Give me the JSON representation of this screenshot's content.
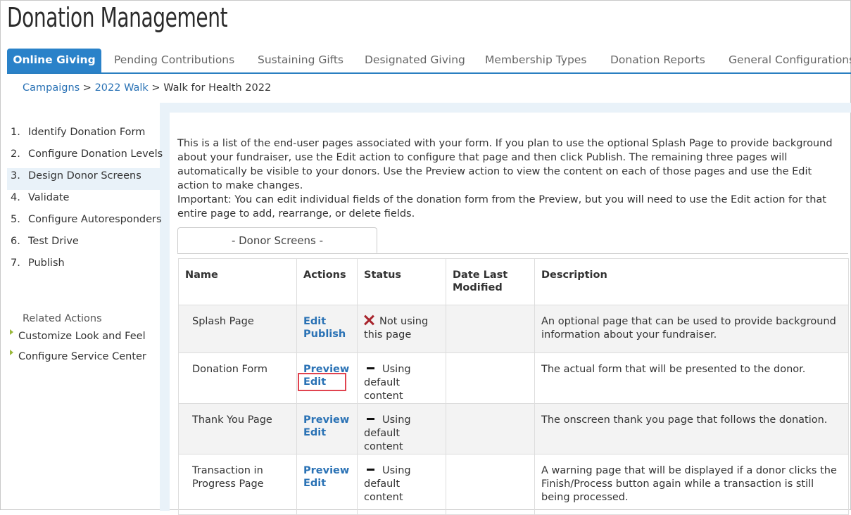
{
  "app": {
    "title": "Donation Management"
  },
  "tabs": [
    {
      "label": "Online Giving",
      "active": true
    },
    {
      "label": "Pending Contributions"
    },
    {
      "label": "Sustaining Gifts"
    },
    {
      "label": "Designated Giving"
    },
    {
      "label": "Membership Types"
    },
    {
      "label": "Donation Reports"
    },
    {
      "label": "General Configurations"
    }
  ],
  "breadcrumb": {
    "campaigns": "Campaigns",
    "sep1": " > ",
    "walk": "2022 Walk",
    "sep2": " > ",
    "current": "Walk for Health 2022"
  },
  "steps": [
    {
      "num": "1.",
      "label": "Identify Donation Form"
    },
    {
      "num": "2.",
      "label": "Configure Donation Levels"
    },
    {
      "num": "3.",
      "label": "Design Donor Screens",
      "active": true
    },
    {
      "num": "4.",
      "label": "Validate"
    },
    {
      "num": "5.",
      "label": "Configure Autoresponders"
    },
    {
      "num": "6.",
      "label": "Test Drive"
    },
    {
      "num": "7.",
      "label": "Publish"
    }
  ],
  "related": {
    "heading": "Related Actions",
    "items": [
      "Customize Look and Feel",
      "Configure Service Center"
    ]
  },
  "intro": "This is a list of the end-user pages associated with your form. If you plan to use the optional Splash Page to provide background about your fundraiser, use the Edit action to configure that page and then click Publish. The remaining three pages will automatically be visible to your donors. Use the Preview action to view the content on each of those pages and use the Edit action to make changes.",
  "important": "Important: You can edit individual fields of the donation form from the Preview, but you will need to use the Edit action for that entire page to add, rearrange, or delete fields.",
  "subtab": "- Donor Screens -",
  "table": {
    "headers": [
      "Name",
      "Actions",
      "Status",
      "Date Last Modified",
      "Description"
    ],
    "rows": [
      {
        "name": "Splash Page",
        "action1": "Edit",
        "action2": "Publish",
        "status": "Not using this page",
        "date": "",
        "description": "An optional page that can be used to provide background information about your fundraiser."
      },
      {
        "name": "Donation Form",
        "action1": "Preview",
        "action2": "Edit",
        "status": "Using default content",
        "date": "",
        "description": "The actual form that will be presented to the donor."
      },
      {
        "name": "Thank You Page",
        "action1": "Preview",
        "action2": "Edit",
        "status": "Using default content",
        "date": "",
        "description": "The onscreen thank you page that follows the donation."
      },
      {
        "name": "Transaction in Progress Page",
        "action1": "Preview",
        "action2": "Edit",
        "status": "Using default content",
        "date": "",
        "description": "A warning page that will be displayed if a donor clicks the Finish/Process button again while a transaction is still being processed."
      }
    ]
  },
  "colors": {
    "accent": "#2a82c9",
    "link": "#2a72b5",
    "highlight": "#e0434f",
    "not_using_icon": "#a8242c"
  }
}
